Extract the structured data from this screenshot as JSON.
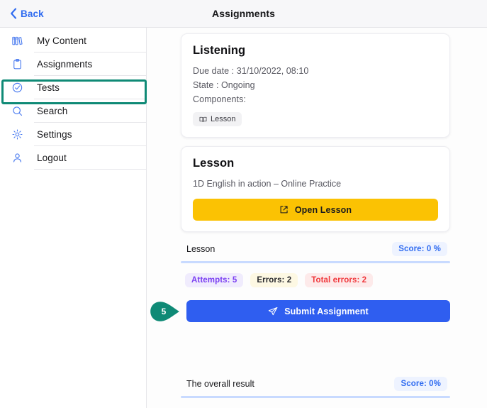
{
  "header": {
    "back_label": "Back",
    "back_icon": "chevron-left-icon",
    "title": "Assignments"
  },
  "sidebar": {
    "items": [
      {
        "label": "My Content",
        "icon": "books-icon",
        "active": false
      },
      {
        "label": "Assignments",
        "icon": "clipboard-icon",
        "active": true
      },
      {
        "label": "Tests",
        "icon": "check-circle-icon",
        "active": false
      },
      {
        "label": "Search",
        "icon": "search-icon",
        "active": false
      },
      {
        "label": "Settings",
        "icon": "gear-icon",
        "active": false
      },
      {
        "label": "Logout",
        "icon": "person-icon",
        "active": false
      }
    ],
    "highlight_color": "#0f8a76"
  },
  "assignment_card": {
    "title": "Listening",
    "due_date": "Due date : 31/10/2022, 08:10",
    "state": "State : Ongoing",
    "components_label": "Components:",
    "component_chip": "Lesson",
    "component_chip_icon": "book-open-icon"
  },
  "lesson_card": {
    "title": "Lesson",
    "description": "1D English in action – Online Practice",
    "open_button_label": "Open Lesson",
    "open_button_icon": "external-link-icon",
    "open_button_color": "#fbc203"
  },
  "lesson_result": {
    "name": "Lesson",
    "score_badge": "Score: 0 %",
    "stats": [
      {
        "label": "Attempts: 5",
        "color": "#7b3ff2"
      },
      {
        "label": "Errors: 2",
        "color": "#2a2a2e"
      },
      {
        "label": "Total errors: 2",
        "color": "#f0383c"
      }
    ]
  },
  "submit": {
    "label": "Submit Assignment",
    "icon": "send-icon",
    "color": "#2f5ef0",
    "callout_number": "5",
    "callout_color": "#0f8a76"
  },
  "overall_result": {
    "name": "The overall result",
    "score_badge": "Score: 0%"
  }
}
